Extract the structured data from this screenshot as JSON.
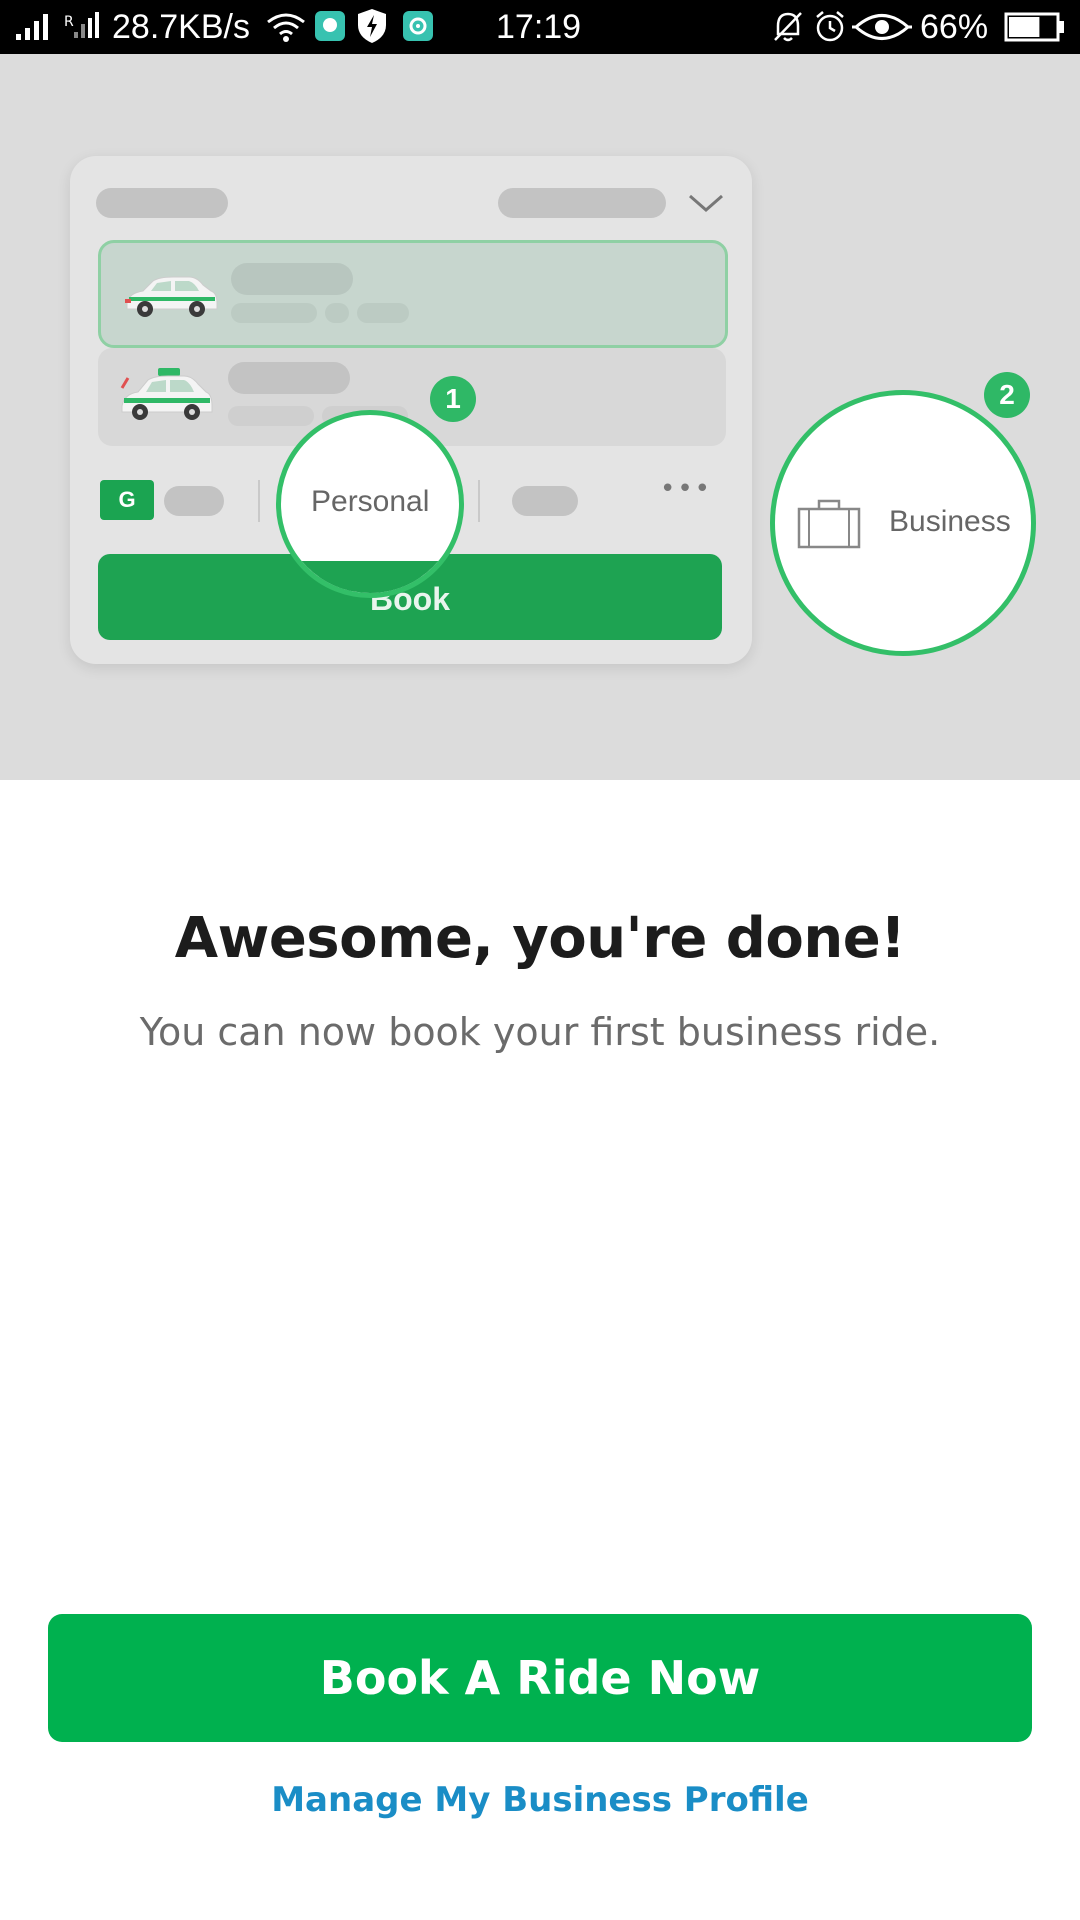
{
  "status_bar": {
    "net_speed": "28.7KB/s",
    "time": "17:19",
    "battery": "66%",
    "battery_level": 0.66
  },
  "illustration": {
    "mini_book_label": "Book",
    "payment_icon_letter": "G",
    "more_label": "•••",
    "personal_label": "Personal",
    "business_label": "Business",
    "step1_badge": "1",
    "step2_badge": "2",
    "accent_color": "#33bf68"
  },
  "content": {
    "title": "Awesome, you're done!",
    "subtitle": "You can now book your first business ride."
  },
  "actions": {
    "primary_label": "Book A Ride Now",
    "secondary_label": "Manage My Business Profile",
    "primary_color": "#00b14f",
    "link_color": "#1a8dc6"
  }
}
